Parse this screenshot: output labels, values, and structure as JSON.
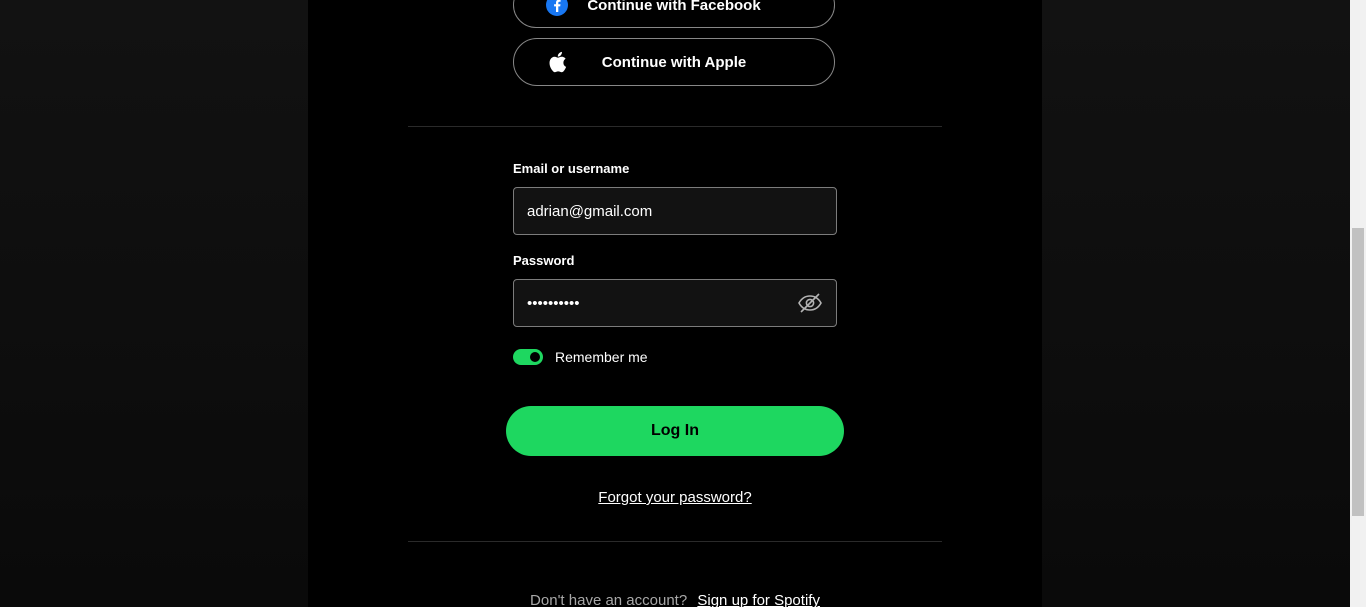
{
  "social": {
    "facebook_label": "Continue with Facebook",
    "apple_label": "Continue with Apple"
  },
  "form": {
    "email_label": "Email or username",
    "email_value": "adrian@gmail.com",
    "password_label": "Password",
    "password_value": "••••••••••",
    "remember_label": "Remember me",
    "remember_on": true,
    "login_label": "Log In",
    "forgot_label": "Forgot your password?"
  },
  "signup": {
    "prompt": "Don't have an account?",
    "link_label": "Sign up for Spotify"
  },
  "colors": {
    "accent": "#1ed760",
    "background": "#000000",
    "facebook_blue": "#1877f2"
  },
  "icons": {
    "facebook": "facebook-icon",
    "apple": "apple-icon",
    "eye": "eye-slash-icon"
  }
}
